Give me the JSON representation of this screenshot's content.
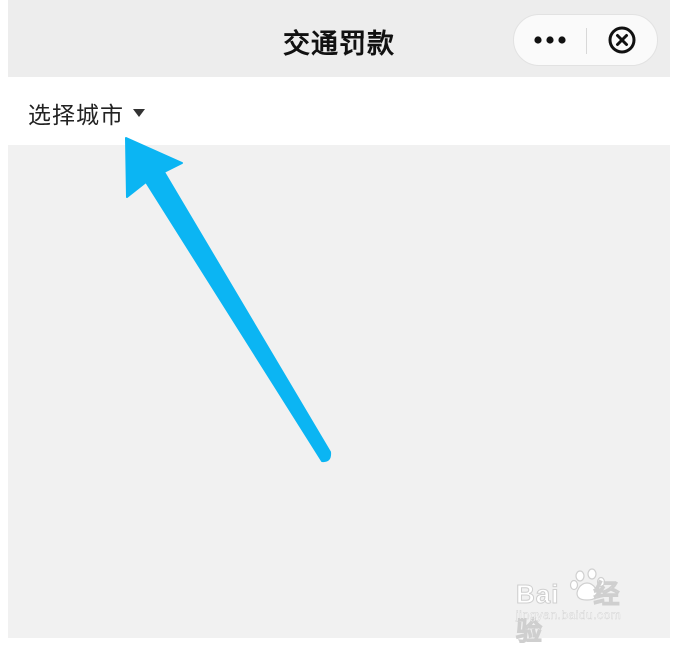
{
  "nav": {
    "title": "交通罚款"
  },
  "capsule": {
    "more_icon": "more-dots-icon",
    "close_icon": "circle-close-icon"
  },
  "city": {
    "label": "选择城市",
    "caret_icon": "caret-down-icon"
  },
  "annotation": {
    "arrow_color": "#0bb5f3"
  },
  "watermark": {
    "brand_left": "Bai",
    "brand_right": "经验",
    "url": "jingyan.baidu.com"
  }
}
